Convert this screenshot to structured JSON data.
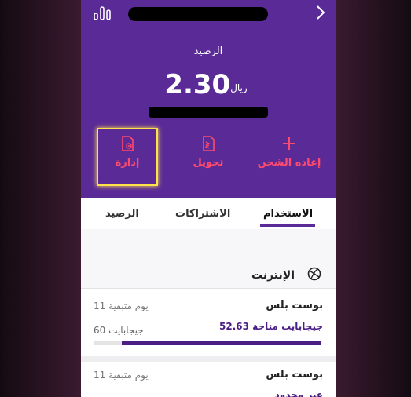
{
  "header": {
    "balance_label": "الرصيد",
    "amount": "2.30",
    "currency": "ريال"
  },
  "actions": [
    {
      "label": "إعاده الشحن",
      "icon": "plus-icon"
    },
    {
      "label": "تحويل",
      "icon": "transfer-icon"
    },
    {
      "label": "إدارة",
      "icon": "manage-document-icon"
    }
  ],
  "tabs": {
    "usage": "الاستخدام",
    "subscriptions": "الاشتراكات",
    "balance": "الرصيد",
    "selected": "usage"
  },
  "section": {
    "title": "الإنترنت",
    "icon": "internet-globe-icon"
  },
  "packages": [
    {
      "name": "بوست بلس",
      "days_left": "11 يوم متبقية",
      "available": "52.63 جيجابايت متاحة",
      "total": "60 جيجابايت",
      "progress_fraction": 0.877
    },
    {
      "name": "بوست بلس",
      "days_left": "11 يوم متبقية",
      "available": "غير محدود"
    }
  ],
  "colors": {
    "brand_purple": "#5a2a97",
    "accent_red": "#ff4a6e",
    "highlight_yellow": "#ffe24a",
    "bar_purple": "#4b1e86"
  }
}
